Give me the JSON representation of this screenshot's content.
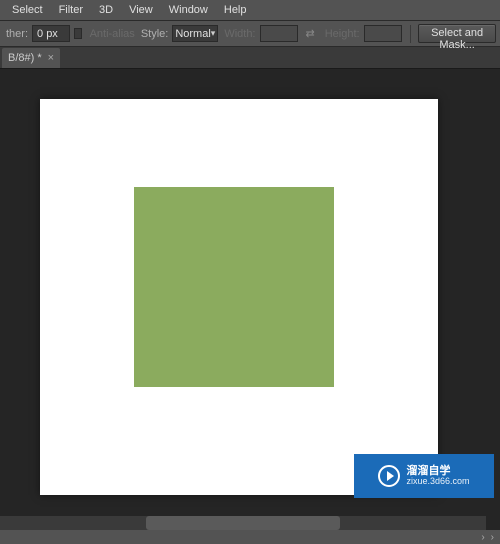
{
  "menubar": {
    "items": [
      "Select",
      "Filter",
      "3D",
      "View",
      "Window",
      "Help"
    ]
  },
  "options": {
    "feather_label": "ther:",
    "feather_value": "0 px",
    "antialias_label": "Anti-alias",
    "style_label": "Style:",
    "style_value": "Normal",
    "width_label": "Width:",
    "width_value": "",
    "height_label": "Height:",
    "height_value": "",
    "select_mask_label": "Select and Mask..."
  },
  "tab": {
    "title": "B/8#) *",
    "close": "×"
  },
  "watermark": {
    "main": "溜溜自学",
    "sub": "zixue.3d66.com"
  },
  "colors": {
    "canvas_bg": "#ffffff",
    "shape_fill": "#8bab5e",
    "workspace_bg": "#252525",
    "chrome_bg": "#535353",
    "watermark_bg": "#1b6bb8"
  }
}
